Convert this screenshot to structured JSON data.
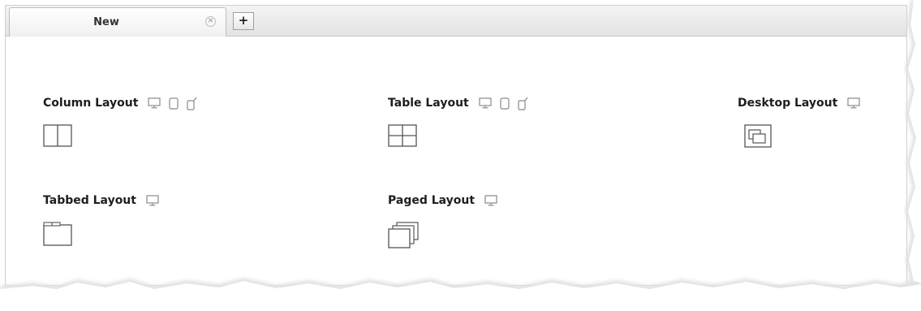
{
  "tabs": [
    {
      "label": "New",
      "close_icon": "close-icon"
    }
  ],
  "add_tab": {
    "label": "+"
  },
  "layouts": [
    {
      "id": "column",
      "title": "Column Layout",
      "devices": [
        "desktop-icon",
        "tablet-icon",
        "phone-icon"
      ],
      "icon": "column-layout-icon"
    },
    {
      "id": "table",
      "title": "Table Layout",
      "devices": [
        "desktop-icon",
        "tablet-icon",
        "phone-icon"
      ],
      "icon": "table-layout-icon"
    },
    {
      "id": "desktop",
      "title": "Desktop Layout",
      "devices": [
        "desktop-icon"
      ],
      "icon": "desktop-layout-icon"
    },
    {
      "id": "tabbed",
      "title": "Tabbed Layout",
      "devices": [
        "desktop-icon"
      ],
      "icon": "tabbed-layout-icon"
    },
    {
      "id": "paged",
      "title": "Paged Layout",
      "devices": [
        "desktop-icon"
      ],
      "icon": "paged-layout-icon"
    }
  ],
  "colors": {
    "icon_stroke": "#555555",
    "device_stroke": "#8a8a8a"
  }
}
